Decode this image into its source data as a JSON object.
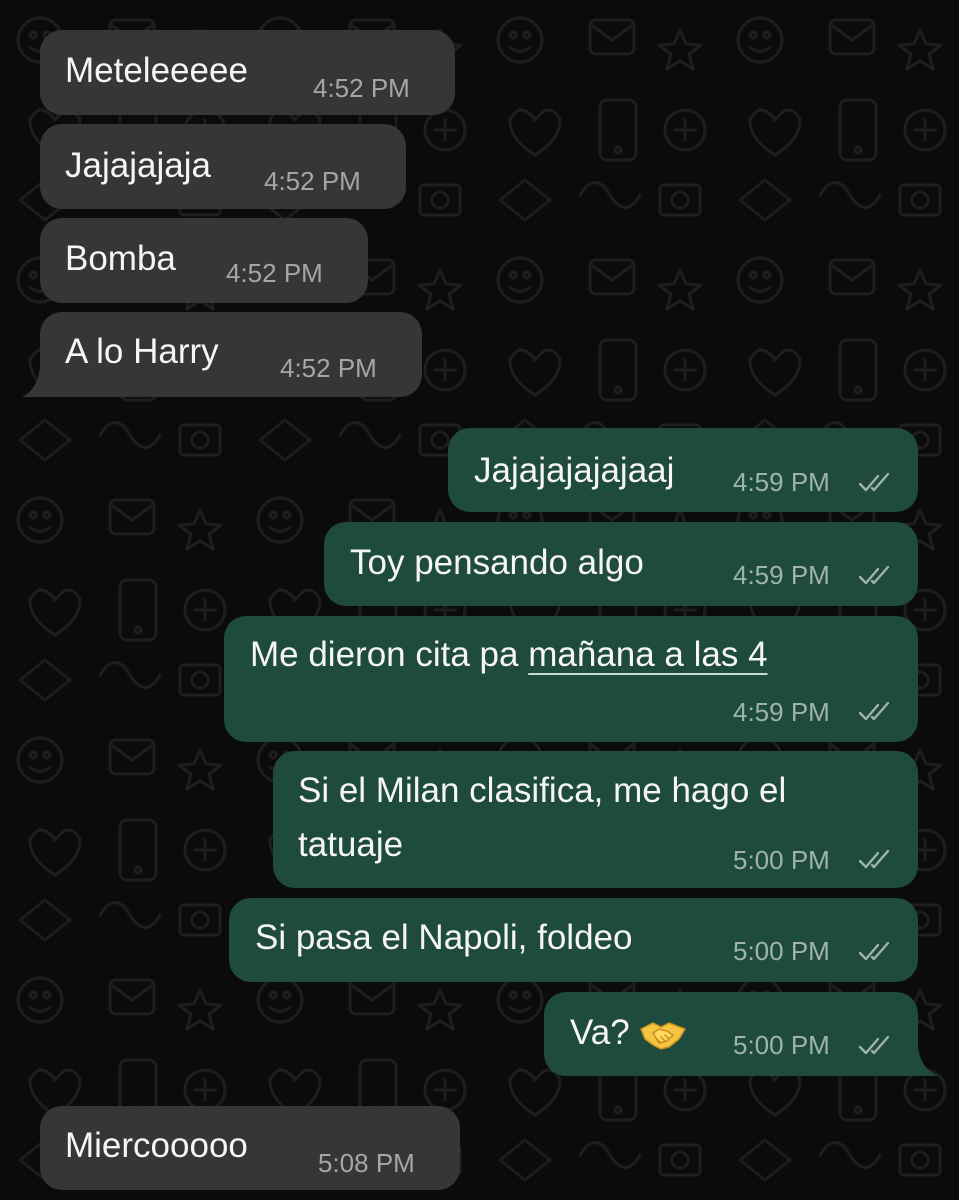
{
  "messages": [
    {
      "id": "m1",
      "direction": "incoming",
      "text": "Meteleeeee",
      "time": "4:52 PM"
    },
    {
      "id": "m2",
      "direction": "incoming",
      "text": "Jajajajaja",
      "time": "4:52 PM"
    },
    {
      "id": "m3",
      "direction": "incoming",
      "text": "Bomba",
      "time": "4:52 PM"
    },
    {
      "id": "m4",
      "direction": "incoming",
      "text": "A lo Harry",
      "time": "4:52 PM"
    },
    {
      "id": "m5",
      "direction": "outgoing",
      "text": "Jajajajajajaaj",
      "time": "4:59 PM",
      "status": "read"
    },
    {
      "id": "m6",
      "direction": "outgoing",
      "text": "Toy pensando algo",
      "time": "4:59 PM",
      "status": "read"
    },
    {
      "id": "m7",
      "direction": "outgoing",
      "text_before_link": "Me dieron cita pa ",
      "link_text": "mañana a las 4",
      "time": "4:59 PM",
      "status": "read"
    },
    {
      "id": "m8",
      "direction": "outgoing",
      "line1": "Si el Milan clasifica, me hago el",
      "line2": "tatuaje",
      "time": "5:00 PM",
      "status": "read"
    },
    {
      "id": "m9",
      "direction": "outgoing",
      "text": "Si pasa el Napoli, foldeo",
      "time": "5:00 PM",
      "status": "read"
    },
    {
      "id": "m10",
      "direction": "outgoing",
      "text": "Va?",
      "emoji": "handshake-emoji",
      "time": "5:00 PM",
      "status": "read"
    },
    {
      "id": "m11",
      "direction": "incoming",
      "text": "Miercooooo",
      "time": "5:08 PM"
    }
  ],
  "colors": {
    "background": "#0b0b0c",
    "incoming_bubble": "#363638",
    "outgoing_bubble": "#1f4a3e",
    "text": "#f5f5f5",
    "timestamp": "#9aa3a0",
    "read_ticks": "#9fb3ac"
  },
  "icons": {
    "read_receipt": "double-check-icon",
    "wallpaper": "doodle-pattern"
  }
}
